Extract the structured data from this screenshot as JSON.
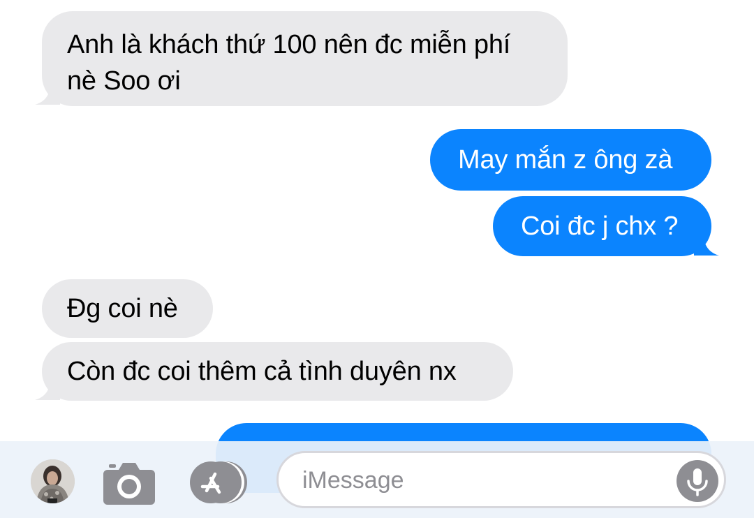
{
  "messages": [
    {
      "id": "m1",
      "direction": "incoming",
      "text": "Anh là khách thứ 100 nên đc miễn phí nè Soo ơi"
    },
    {
      "id": "m2",
      "direction": "outgoing",
      "text": "May mắn z ông zà"
    },
    {
      "id": "m3",
      "direction": "outgoing",
      "text": "Coi đc j chx ?"
    },
    {
      "id": "m4",
      "direction": "incoming",
      "text": "Đg coi nè"
    },
    {
      "id": "m5",
      "direction": "incoming",
      "text": "Còn đc coi thêm cả tình duyên nx"
    },
    {
      "id": "m6",
      "direction": "outgoing",
      "text": ""
    }
  ],
  "composer": {
    "placeholder": "iMessage",
    "value": ""
  },
  "icons": {
    "avatar": "contact-avatar",
    "camera": "camera-icon",
    "apps": "app-store-icon",
    "mic": "microphone-icon"
  },
  "colors": {
    "incoming_bubble": "#e9e9eb",
    "outgoing_bubble": "#0b84fe",
    "composer_bar": "#ecf2fa",
    "icon_gray": "#8e8e93"
  }
}
